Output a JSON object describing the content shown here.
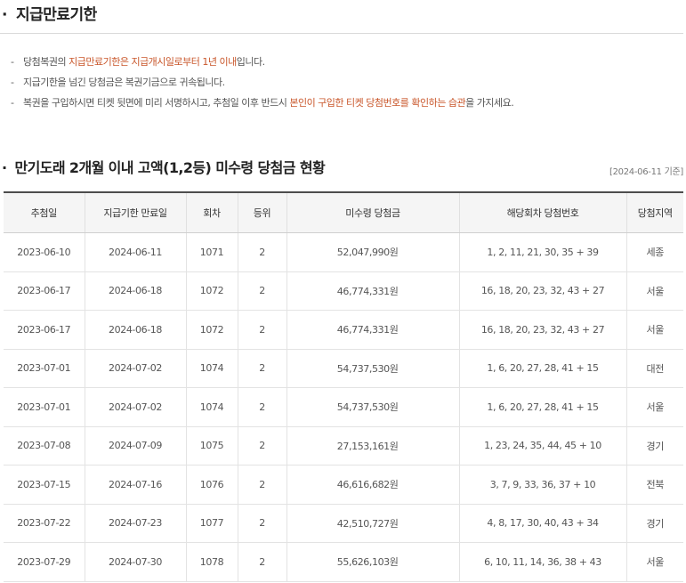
{
  "section1": {
    "bullet": "·",
    "title": "지급만료기한",
    "notes": [
      {
        "pre": "당첨복권의 ",
        "hl": "지급만료기한은 지급개시일로부터 1년 이내",
        "post": "입니다."
      },
      {
        "pre": "지급기한을 넘긴 당첨금은 복권기금으로 귀속됩니다.",
        "hl": "",
        "post": ""
      },
      {
        "pre": "복권을 구입하시면 티켓 뒷면에 미리 서명하시고, 추첨일 이후 반드시 ",
        "hl": "본인이 구입한 티켓 당첨번호를 확인하는 습관",
        "post": "을 가지세요."
      }
    ]
  },
  "section2": {
    "bullet": "·",
    "title": "만기도래 2개월 이내 고액(1,2등) 미수령 당첨금 현황",
    "basis": "[2024-06-11 기준]",
    "columns": [
      "추첨일",
      "지급기한 만료일",
      "회차",
      "등위",
      "미수령 당첨금",
      "해당회차 당첨번호",
      "당첨지역"
    ],
    "rows": [
      [
        "2023-06-10",
        "2024-06-11",
        "1071",
        "2",
        "52,047,990원",
        "1, 2, 11, 21, 30, 35 + 39",
        "세종"
      ],
      [
        "2023-06-17",
        "2024-06-18",
        "1072",
        "2",
        "46,774,331원",
        "16, 18, 20, 23, 32, 43 + 27",
        "서울"
      ],
      [
        "2023-06-17",
        "2024-06-18",
        "1072",
        "2",
        "46,774,331원",
        "16, 18, 20, 23, 32, 43 + 27",
        "서울"
      ],
      [
        "2023-07-01",
        "2024-07-02",
        "1074",
        "2",
        "54,737,530원",
        "1, 6, 20, 27, 28, 41 + 15",
        "대전"
      ],
      [
        "2023-07-01",
        "2024-07-02",
        "1074",
        "2",
        "54,737,530원",
        "1, 6, 20, 27, 28, 41 + 15",
        "서울"
      ],
      [
        "2023-07-08",
        "2024-07-09",
        "1075",
        "2",
        "27,153,161원",
        "1, 23, 24, 35, 44, 45 + 10",
        "경기"
      ],
      [
        "2023-07-15",
        "2024-07-16",
        "1076",
        "2",
        "46,616,682원",
        "3, 7, 9, 33, 36, 37 + 10",
        "전북"
      ],
      [
        "2023-07-22",
        "2024-07-23",
        "1077",
        "2",
        "42,510,727원",
        "4, 8, 17, 30, 40, 43 + 34",
        "경기"
      ],
      [
        "2023-07-29",
        "2024-07-30",
        "1078",
        "2",
        "55,626,103원",
        "6, 10, 11, 14, 36, 38 + 43",
        "서울"
      ]
    ]
  },
  "colors": {
    "highlight": "#c9572b",
    "header_bg": "#f5f5f5",
    "border": "#e3e3e3"
  }
}
